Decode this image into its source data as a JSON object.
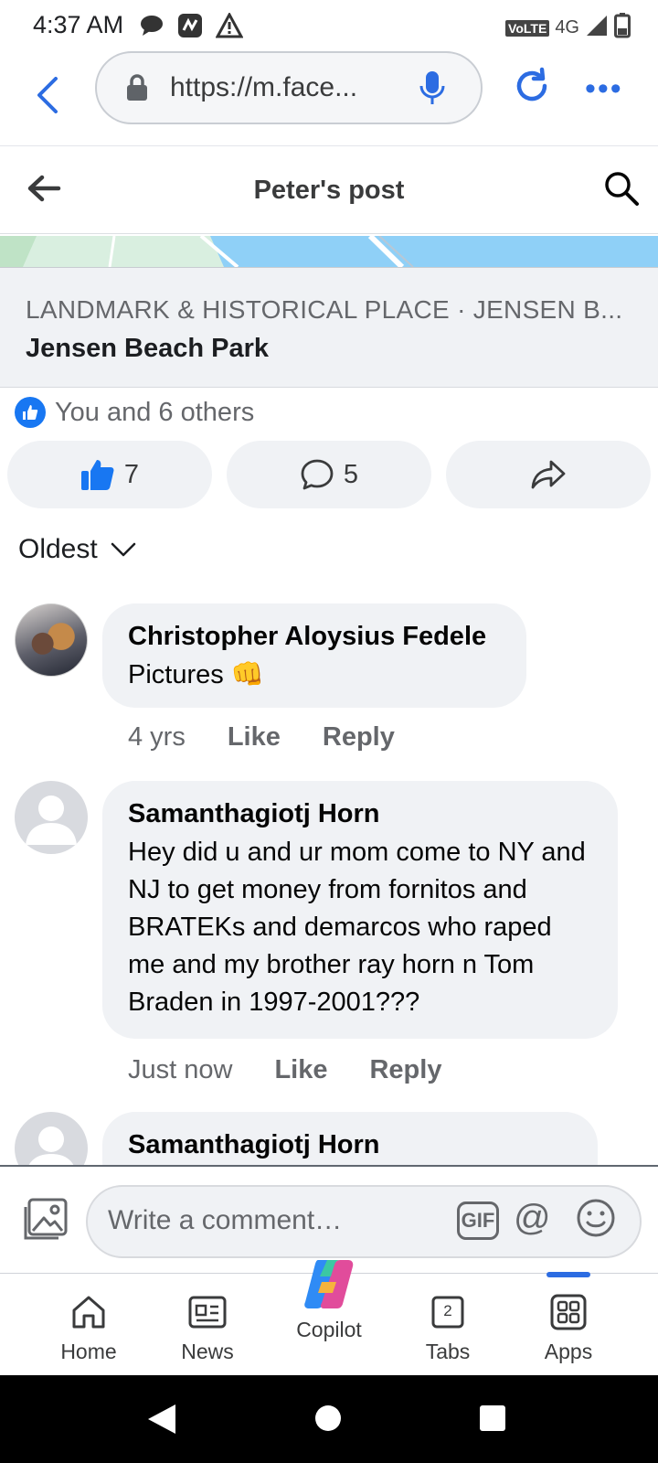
{
  "status_bar": {
    "time": "4:37 AM",
    "network": "4G",
    "volte": "VoLTE"
  },
  "browser": {
    "url": "https://m.face...",
    "more_label": "•••"
  },
  "header": {
    "title": "Peter's post"
  },
  "place": {
    "category": "LANDMARK & HISTORICAL PLACE · JENSEN B...",
    "name": "Jensen Beach Park"
  },
  "reactions": {
    "summary": "You and 6 others",
    "like_count": "7",
    "comment_count": "5"
  },
  "sort": {
    "label": "Oldest"
  },
  "comments": [
    {
      "author": "Christopher Aloysius Fedele",
      "text": "Pictures 👊",
      "time": "4 yrs",
      "like": "Like",
      "reply": "Reply"
    },
    {
      "author": "Samanthagiotj Horn",
      "text": "Hey did u and ur mom come to NY and NJ to get money from fornitos and BRATEKs and demarcos who raped me and my brother ray horn n Tom Braden in 1997-2001???",
      "time": "Just now",
      "like": "Like",
      "reply": "Reply"
    },
    {
      "author": "Samanthagiotj Horn"
    }
  ],
  "composer": {
    "placeholder": "Write a comment…",
    "gif_label": "GIF",
    "at_label": "@"
  },
  "bottom_nav": {
    "items": [
      {
        "label": "Home",
        "icon": "home-icon"
      },
      {
        "label": "News",
        "icon": "news-icon"
      },
      {
        "label": "Copilot",
        "icon": "copilot-icon"
      },
      {
        "label": "Tabs",
        "icon": "tabs-icon",
        "badge": "2"
      },
      {
        "label": "Apps",
        "icon": "apps-icon"
      }
    ]
  },
  "colors": {
    "accent": "#2c6ce2",
    "facebook_blue": "#1877f2",
    "bubble_bg": "#f0f2f5",
    "secondary_text": "#65676b"
  }
}
